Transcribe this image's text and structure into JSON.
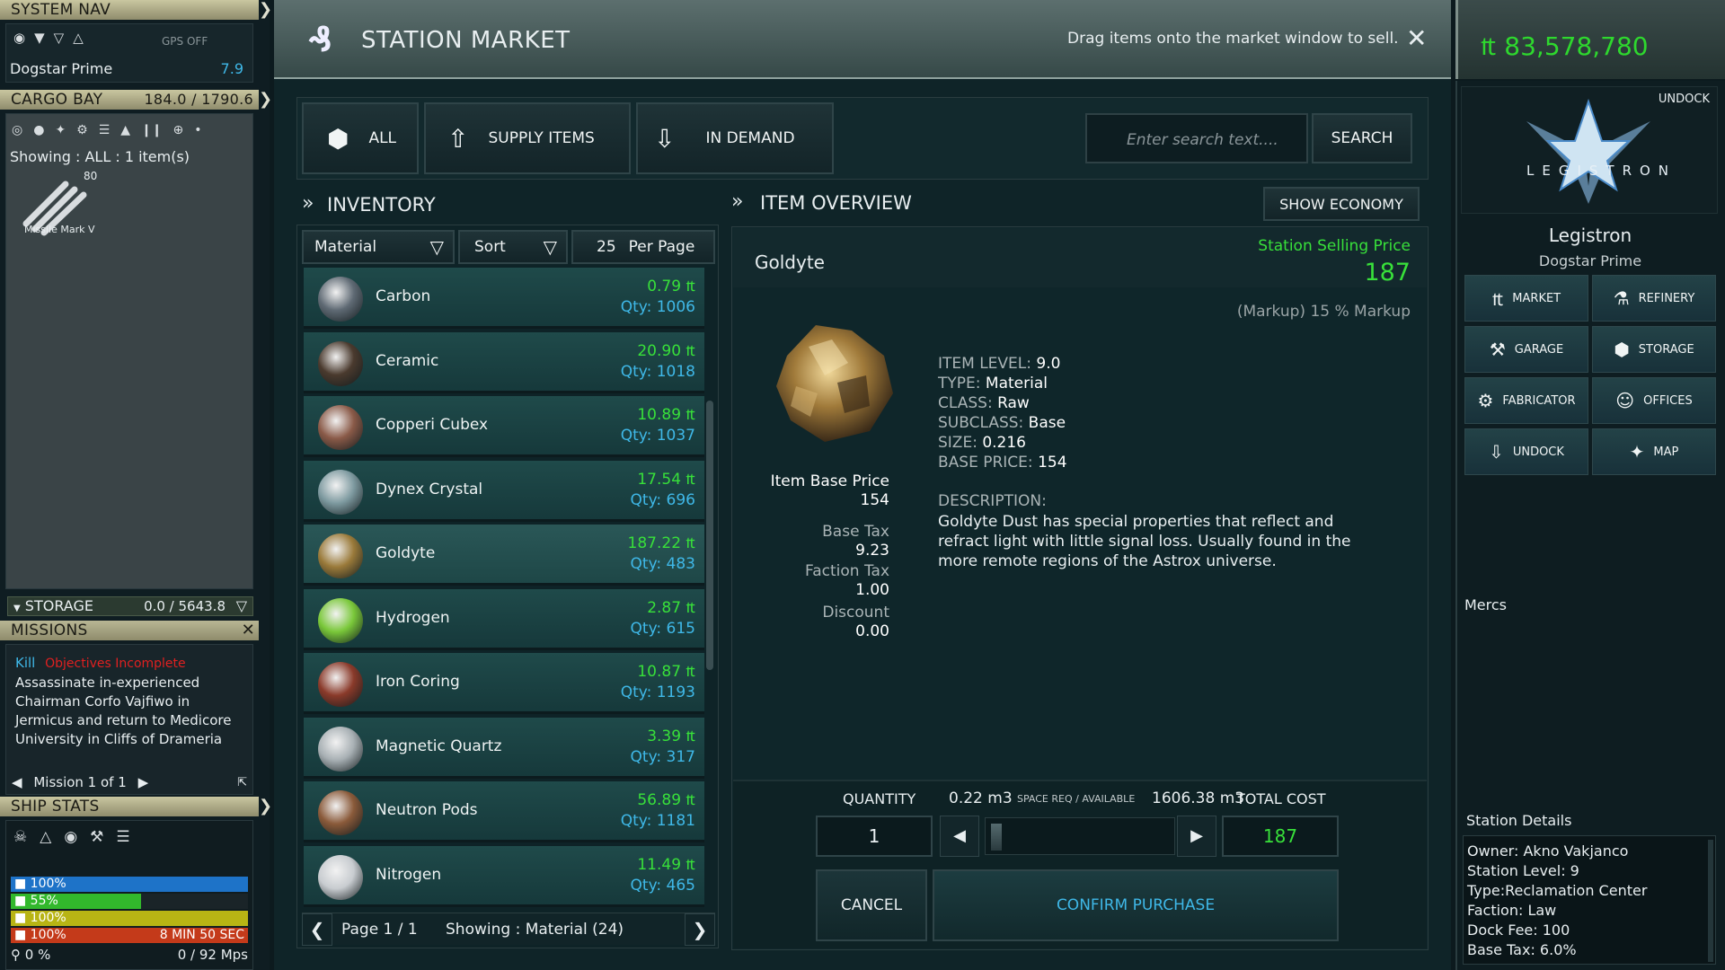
{
  "left": {
    "system_nav": {
      "title": "SYSTEM NAV",
      "gps": "GPS OFF",
      "location": "Dogstar Prime",
      "value": "7.9",
      "icons": [
        "target-icon",
        "route-icon",
        "filter-icon",
        "ship-icon"
      ]
    },
    "cargo_bay": {
      "title": "CARGO BAY",
      "capacity": "184.0 / 1790.6",
      "showing": "Showing : ALL : 1 item(s)",
      "item_count": "80",
      "item_name": "Missile Mark V",
      "icons": [
        "ring-icon",
        "ball-icon",
        "drone-icon",
        "gear-icon",
        "stack-icon",
        "rocket-icon",
        "bars-icon",
        "plus-circle-icon",
        "dot-icon"
      ]
    },
    "storage": {
      "title": "STORAGE",
      "capacity": "0.0 / 5643.8"
    },
    "missions": {
      "title": "MISSIONS",
      "type": "Kill",
      "status": "Objectives Incomplete",
      "description": "Assassinate in-experienced Chairman Corfo Vajfiwo in Jermicus and return to Medicore University in Cliffs of Drameria",
      "pager": "Mission 1 of 1"
    },
    "ship_stats": {
      "title": "SHIP STATS",
      "bars": [
        {
          "label": "100%",
          "fill": 1.0,
          "color": "#1e73c8"
        },
        {
          "label": "55%",
          "fill": 0.55,
          "color": "#32b82c"
        },
        {
          "label": "100%",
          "fill": 1.0,
          "color": "#b8b414"
        },
        {
          "label": "100%",
          "fill": 1.0,
          "color": "#c43a1a",
          "extra": "8 MIN 50 SEC"
        }
      ],
      "speed_pct": "0 %",
      "speed": "0  /  92 Mps"
    }
  },
  "top": {
    "title": "STATION MARKET",
    "hint": "Drag items onto the market window to sell.",
    "credits": "₶ 83,578,780"
  },
  "filters": {
    "all": "ALL",
    "supply": "SUPPLY ITEMS",
    "demand": "IN DEMAND",
    "search_placeholder": "Enter search text....",
    "search_button": "SEARCH"
  },
  "inventory": {
    "title": "INVENTORY",
    "filter": "Material",
    "sort": "Sort",
    "per_page_n": "25",
    "per_page": "Per Page",
    "items": [
      {
        "name": "Carbon",
        "price": "0.79",
        "qty": "Qty: 1006",
        "color": "#5f6a74"
      },
      {
        "name": "Ceramic",
        "price": "20.90",
        "qty": "Qty: 1018",
        "color": "#4a3a2e"
      },
      {
        "name": "Copperi Cubex",
        "price": "10.89",
        "qty": "Qty: 1037",
        "color": "#8a5a48"
      },
      {
        "name": "Dynex Crystal",
        "price": "17.54",
        "qty": "Qty: 696",
        "color": "#7e9aa0"
      },
      {
        "name": "Goldyte",
        "price": "187.22",
        "qty": "Qty: 483",
        "color": "#9a7a3a"
      },
      {
        "name": "Hydrogen",
        "price": "2.87",
        "qty": "Qty: 615",
        "color": "#7ac83a"
      },
      {
        "name": "Iron Coring",
        "price": "10.87",
        "qty": "Qty: 1193",
        "color": "#8a3a2a"
      },
      {
        "name": "Magnetic Quartz",
        "price": "3.39",
        "qty": "Qty: 317",
        "color": "#a8b0b4"
      },
      {
        "name": "Neutron Pods",
        "price": "56.89",
        "qty": "Qty: 1181",
        "color": "#8a5a3a"
      },
      {
        "name": "Nitrogen",
        "price": "11.49",
        "qty": "Qty: 465",
        "color": "#c8ccd0"
      }
    ],
    "page": "Page 1 / 1",
    "showing": "Showing : Material (24)"
  },
  "overview": {
    "title": "ITEM OVERVIEW",
    "show_economy": "SHOW ECONOMY",
    "item_name": "Goldyte",
    "selling_label": "Station Selling Price",
    "selling_price": "187",
    "markup": "(Markup) 15 % Markup",
    "base_price_label": "Item Base Price",
    "base_price": "154",
    "base_tax_label": "Base Tax",
    "base_tax": "9.23",
    "faction_tax_label": "Faction Tax",
    "faction_tax": "1.00",
    "discount_label": "Discount",
    "discount": "0.00",
    "props": [
      {
        "k": "ITEM LEVEL:",
        "v": "9.0"
      },
      {
        "k": "TYPE:",
        "v": "Material"
      },
      {
        "k": "CLASS:",
        "v": "Raw"
      },
      {
        "k": "SUBCLASS:",
        "v": "Base"
      },
      {
        "k": "SIZE:",
        "v": "0.216"
      },
      {
        "k": "BASE PRICE:",
        "v": "154"
      }
    ],
    "desc_label": "DESCRIPTION:",
    "description": "Goldyte Dust has special properties that reflect and refract light with little signal loss. Usually found in the more remote regions of the Astrox universe.",
    "quantity_label": "QUANTITY",
    "space": "0.22 m3",
    "space_label": "SPACE REQ / AVAILABLE",
    "available": "1606.38 m3",
    "total_label": "TOTAL COST",
    "quantity": "1",
    "total": "187",
    "cancel": "CANCEL",
    "confirm": "CONFIRM PURCHASE"
  },
  "station": {
    "undock": "UNDOCK",
    "logo_text": "LEGISTRON",
    "name": "Legistron",
    "location": "Dogstar Prime",
    "buttons": [
      "MARKET",
      "REFINERY",
      "GARAGE",
      "STORAGE",
      "FABRICATOR",
      "OFFICES",
      "UNDOCK",
      "MAP"
    ],
    "mercs": "Mercs",
    "details_title": "Station Details",
    "details": [
      "Owner: Akno Vakjanco",
      "Station Level: 9",
      "Type:Reclamation Center",
      "Faction: Law",
      "Dock Fee: 100",
      "Base Tax: 6.0%"
    ]
  }
}
